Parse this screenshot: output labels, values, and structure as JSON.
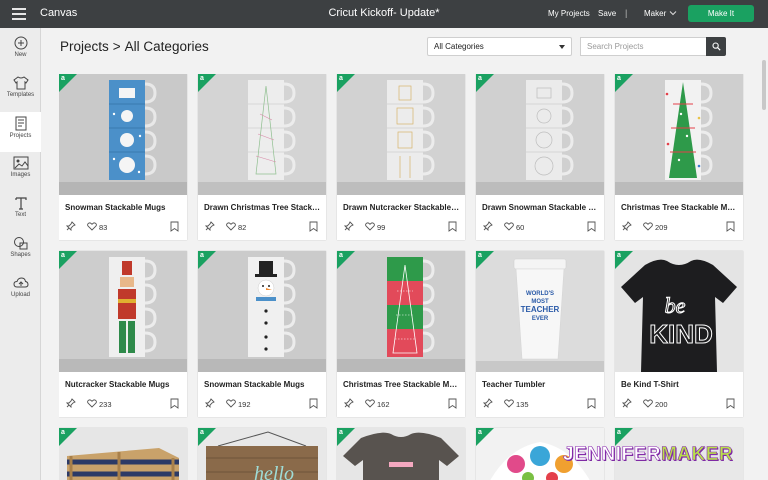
{
  "app": {
    "name": "Canvas",
    "doc_title": "Cricut Kickoff- Update*"
  },
  "topbar": {
    "my_projects": "My Projects",
    "save": "Save",
    "separator": "|",
    "machine": "Maker",
    "make_it": "Make It"
  },
  "sidebar": {
    "items": [
      {
        "label": "New",
        "icon": "plus-circle-icon"
      },
      {
        "label": "Templates",
        "icon": "shirt-icon"
      },
      {
        "label": "Projects",
        "icon": "projects-icon"
      },
      {
        "label": "Images",
        "icon": "image-icon"
      },
      {
        "label": "Text",
        "icon": "text-icon"
      },
      {
        "label": "Shapes",
        "icon": "shapes-icon"
      },
      {
        "label": "Upload",
        "icon": "upload-cloud-icon"
      }
    ]
  },
  "header": {
    "crumb_root": "Projects",
    "crumb_sep": ">",
    "crumb_current": "All Categories",
    "category_value": "All Categories",
    "search_placeholder": "Search Projects"
  },
  "cards": [
    {
      "title": "Snowman Stackable Mugs",
      "likes": "83"
    },
    {
      "title": "Drawn Christmas Tree Stackable Mugs",
      "likes": "82"
    },
    {
      "title": "Drawn Nutcracker Stackable Mugs",
      "likes": "99"
    },
    {
      "title": "Drawn Snowman Stackable Mugs",
      "likes": "60"
    },
    {
      "title": "Christmas Tree Stackable Mugs",
      "likes": "209"
    },
    {
      "title": "Nutcracker Stackable Mugs",
      "likes": "233"
    },
    {
      "title": "Snowman Stackable Mugs",
      "likes": "192"
    },
    {
      "title": "Christmas Tree Stackable Mugs",
      "likes": "162"
    },
    {
      "title": "Teacher Tumbler",
      "likes": "135"
    },
    {
      "title": "Be Kind T-Shirt",
      "likes": "200"
    }
  ],
  "thumb_text": {
    "tumbler": [
      "WORLD'S",
      "MOST",
      "TEACHER",
      "EVER"
    ],
    "shirt": [
      "be",
      "KIND"
    ],
    "sign": "hello"
  },
  "watermark": {
    "part1": "JENNIFER",
    "part2": "MAKER"
  },
  "colors": {
    "topbar": "#3d4042",
    "accent_green": "#1aa161",
    "mug_blue": "#4b90c9",
    "tree_green": "#2e9a4a"
  }
}
